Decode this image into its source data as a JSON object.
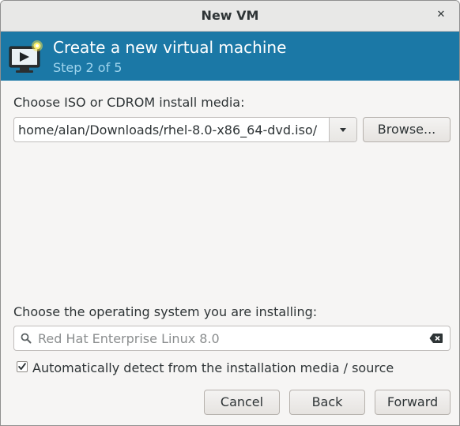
{
  "window": {
    "title": "New VM",
    "close_glyph": "✕"
  },
  "banner": {
    "title": "Create a new virtual machine",
    "step": "Step 2 of 5",
    "icon": "monitor-new-icon"
  },
  "media": {
    "label": "Choose ISO or CDROM install media:",
    "path_value": "/home/alan/Downloads/rhel-8.0-x86_64-dvd.iso",
    "browse_label": "Browse..."
  },
  "os": {
    "label": "Choose the operating system you are installing:",
    "search_placeholder": "Red Hat Enterprise Linux 8.0",
    "search_value": "",
    "auto_detect_label": "Automatically detect from the installation media / source",
    "auto_detect_checked": true
  },
  "footer": {
    "cancel_label": "Cancel",
    "back_label": "Back",
    "forward_label": "Forward"
  },
  "colors": {
    "banner_bg": "#1b78a6",
    "banner_step_text": "#9fd4ed",
    "window_bg": "#f6f5f4"
  }
}
